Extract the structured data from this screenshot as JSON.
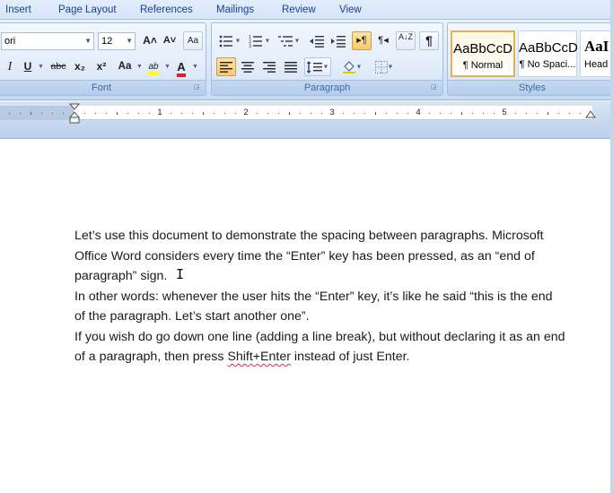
{
  "tabs": [
    {
      "label": "Insert"
    },
    {
      "label": "Page Layout"
    },
    {
      "label": "References"
    },
    {
      "label": "Mailings"
    },
    {
      "label": "Review"
    },
    {
      "label": "View"
    }
  ],
  "font_group": {
    "label": "Font",
    "font_name": "ori",
    "font_size": "12",
    "grow_glyph": "A˄",
    "shrink_glyph": "A˅",
    "clear_format_glyph": "Aa",
    "italic": "I",
    "underline": "U",
    "strikethrough": "abc",
    "subscript": "x₂",
    "superscript": "x²",
    "change_case": "Aa",
    "highlight": "ab",
    "font_color": "A",
    "highlight_color": "#ffff00",
    "font_color_value": "#e02020"
  },
  "paragraph_group": {
    "label": "Paragraph",
    "show_marks": "¶",
    "sort": "A↓Z"
  },
  "styles_group": {
    "label": "Styles",
    "tiles": [
      {
        "sample": "AaBbCcD",
        "name": "¶ Normal"
      },
      {
        "sample": "AaBbCcD",
        "name": "¶ No Spaci..."
      },
      {
        "sample": "AaI",
        "name": "Head"
      }
    ]
  },
  "ruler": {
    "numbers": [
      "1",
      "2",
      "3",
      "4",
      "5"
    ]
  },
  "document": {
    "paragraphs": [
      {
        "lines": [
          "Let’s use this document to demonstrate the spacing between paragraphs. Microsoft",
          "Office Word considers every time the “Enter” key has been pressed, as an “end of",
          "paragraph” sign."
        ]
      },
      {
        "lines": [
          "In other words: whenever the user hits the “Enter” key, it’s like he said “this is the end",
          "of the paragraph. Let’s start another one”."
        ]
      },
      {
        "lines": [
          "If you wish do go down one line (adding a line break), but without declaring it as an end"
        ],
        "last_line_before": "of a paragraph, then press ",
        "last_line_squiggle": "Shift+Enter",
        "last_line_after": " instead of just Enter."
      }
    ]
  },
  "colors": {
    "ribbon_text": "#15428b",
    "active_button": "#fbc96c",
    "selected_style_border": "#e3b15a"
  }
}
